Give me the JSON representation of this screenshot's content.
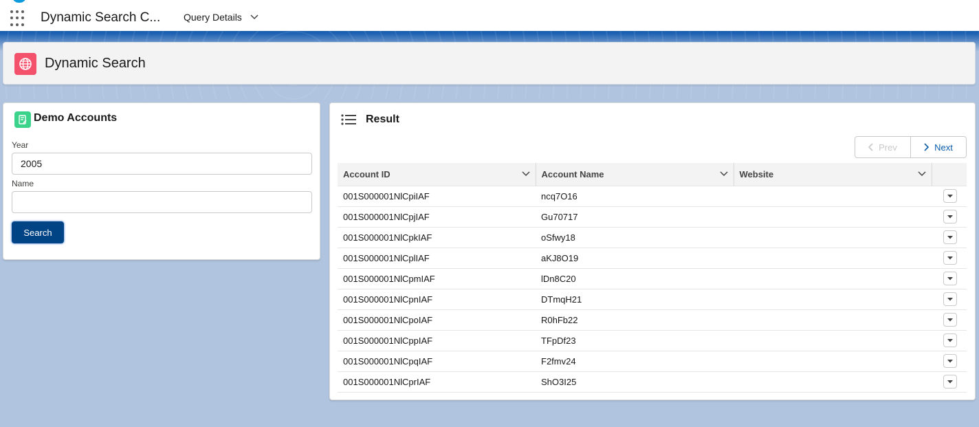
{
  "topbar": {
    "app_name": "Dynamic Search C...",
    "nav_item": "Query Details"
  },
  "page_header": {
    "title": "Dynamic Search"
  },
  "form": {
    "title": "Demo Accounts",
    "year_label": "Year",
    "year_value": "2005",
    "name_label": "Name",
    "name_value": "",
    "search_label": "Search"
  },
  "result": {
    "title": "Result",
    "prev_label": "Prev",
    "next_label": "Next",
    "columns": [
      "Account ID",
      "Account Name",
      "Website"
    ],
    "rows": [
      {
        "id": "001S000001NlCpiIAF",
        "name": "ncq7O16",
        "website": ""
      },
      {
        "id": "001S000001NlCpjIAF",
        "name": "Gu70717",
        "website": ""
      },
      {
        "id": "001S000001NlCpkIAF",
        "name": "oSfwy18",
        "website": ""
      },
      {
        "id": "001S000001NlCplIAF",
        "name": "aKJ8O19",
        "website": ""
      },
      {
        "id": "001S000001NlCpmIAF",
        "name": "lDn8C20",
        "website": ""
      },
      {
        "id": "001S000001NlCpnIAF",
        "name": "DTmqH21",
        "website": ""
      },
      {
        "id": "001S000001NlCpoIAF",
        "name": "R0hFb22",
        "website": ""
      },
      {
        "id": "001S000001NlCppIAF",
        "name": "TFpDf23",
        "website": ""
      },
      {
        "id": "001S000001NlCpqIAF",
        "name": "F2fmv24",
        "website": ""
      },
      {
        "id": "001S000001NlCprIAF",
        "name": "ShO3I25",
        "website": ""
      }
    ]
  },
  "colors": {
    "brand_blue": "#014486",
    "header_icon": "#f4516c",
    "card_icon": "#3bd38b",
    "link_blue": "#0b5cab"
  },
  "icons": {
    "app_launcher": "waffle-icon",
    "header": "globe-icon",
    "card": "form-icon",
    "result": "list-icon",
    "row_action": "chevron-down-icon"
  }
}
